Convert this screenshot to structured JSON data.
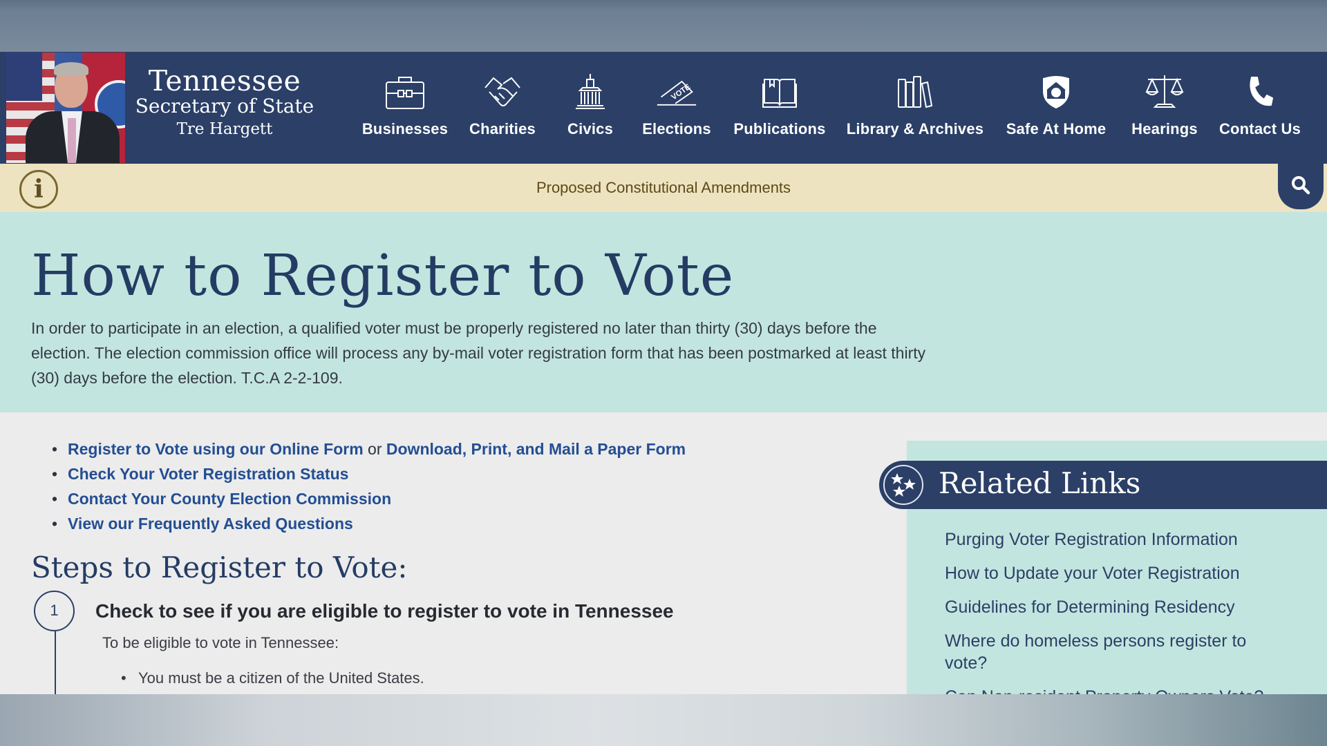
{
  "header": {
    "brand_line1": "Tennessee",
    "brand_line2": "Secretary of State",
    "brand_line3": "Tre Hargett",
    "portrait_alt": "Tre Hargett portrait",
    "nav": [
      {
        "label": "Businesses",
        "icon": "briefcase-icon"
      },
      {
        "label": "Charities",
        "icon": "handshake-icon"
      },
      {
        "label": "Civics",
        "icon": "capitol-icon"
      },
      {
        "label": "Elections",
        "icon": "vote-ballot-icon"
      },
      {
        "label": "Publications",
        "icon": "book-icon"
      },
      {
        "label": "Library & Archives",
        "icon": "books-icon"
      },
      {
        "label": "Safe At Home",
        "icon": "shield-home-icon"
      },
      {
        "label": "Hearings",
        "icon": "scales-icon"
      },
      {
        "label": "Contact Us",
        "icon": "phone-icon"
      }
    ]
  },
  "info_banner": {
    "icon": "info-icon",
    "icon_glyph": "i",
    "link": "Proposed Constitutional Amendments",
    "search_icon": "search-icon"
  },
  "hero": {
    "title": "How to Register to Vote",
    "intro": "In order to participate in an election, a qualified voter must be properly registered no later than thirty (30) days before the election. The election commission office will process any by-mail voter registration form that has been postmarked at least thirty (30) days before the election. T.C.A 2-2-109."
  },
  "quick_links": {
    "item1_link_a": "Register to Vote using our Online Form",
    "item1_separator": " or ",
    "item1_link_b": "Download, Print, and Mail a Paper Form",
    "item2": "Check Your Voter Registration Status",
    "item3": "Contact Your County Election Commission",
    "item4": "View our Frequently Asked Questions"
  },
  "steps": {
    "title": "Steps to Register to Vote:",
    "step1": {
      "number": "1",
      "title": "Check to see if you are eligible to register to vote in Tennessee",
      "subtitle": "To be eligible to vote in Tennessee:",
      "bullets": [
        "You must be a citizen of the United States."
      ]
    }
  },
  "related_links": {
    "title": "Related Links",
    "items": [
      "Purging Voter Registration Information",
      "How to Update your Voter Registration",
      "Guidelines for Determining Residency",
      "Where do homeless persons register to vote?",
      "Can Non-resident Property Owners Vote?"
    ]
  },
  "colors": {
    "navy": "#2b3f67",
    "banner_cream": "#ede3c0",
    "hero_mint": "#c3e5df",
    "link_blue": "#234e93",
    "content_bg": "#ececec"
  }
}
